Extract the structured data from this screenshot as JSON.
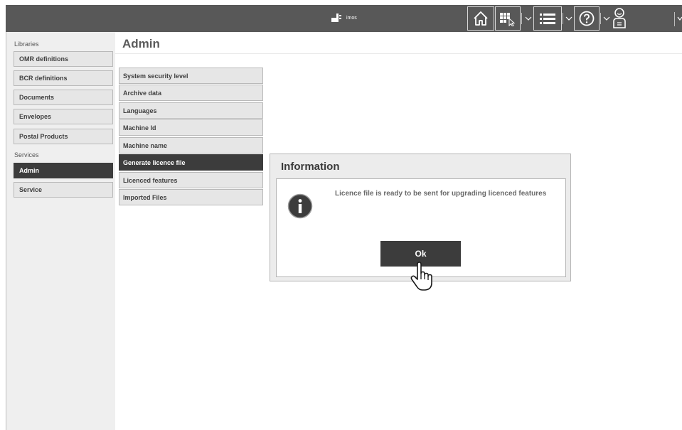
{
  "header": {
    "brand_name": "imos",
    "icons": [
      "home-icon",
      "grid-select-icon",
      "list-icon",
      "help-icon",
      "user-icon"
    ]
  },
  "sidebar": {
    "libraries_label": "Libraries",
    "library_items": [
      "OMR definitions",
      "BCR definitions",
      "Documents",
      "Envelopes",
      "Postal Products"
    ],
    "services_label": "Services",
    "service_items": [
      "Admin",
      "Service"
    ],
    "active_item": "Admin"
  },
  "main": {
    "title": "Admin",
    "menu_items": [
      "System security level",
      "Archive data",
      "Languages",
      "Machine Id",
      "Machine name",
      "Generate licence file",
      "Licenced features",
      "Imported Files"
    ],
    "active_menu_item": "Generate licence file"
  },
  "dialog": {
    "title": "Information",
    "message": "Licence file is ready to be sent for upgrading licenced features",
    "ok_label": "Ok",
    "icon": "info-icon"
  },
  "colors": {
    "topbar": "#585858",
    "active_item": "#3c3c3c",
    "sidebar_bg": "#efefef",
    "button_bg": "#e6e6e6"
  }
}
